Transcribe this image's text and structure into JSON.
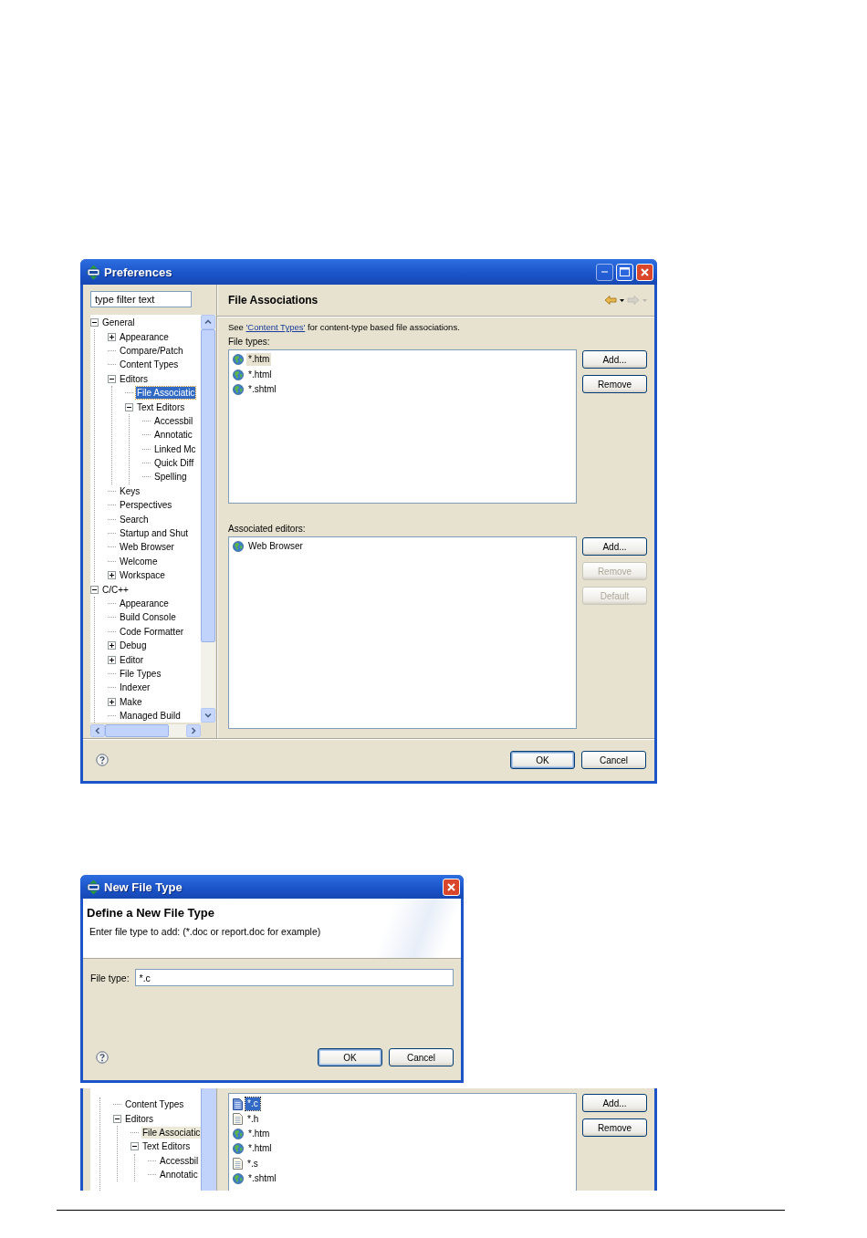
{
  "preferences": {
    "title": "Preferences",
    "filter": {
      "placeholder": "type filter text"
    },
    "tree": {
      "focused": true,
      "items": [
        {
          "label": "General",
          "expanded": true,
          "selected": false,
          "children": [
            {
              "label": "Appearance",
              "expanded": false,
              "selected": false
            },
            {
              "label": "Compare/Patch",
              "selected": false
            },
            {
              "label": "Content Types",
              "selected": false
            },
            {
              "label": "Editors",
              "expanded": true,
              "selected": false,
              "children": [
                {
                  "label": "File Associatic",
                  "selected": true
                },
                {
                  "label": "Text Editors",
                  "expanded": true,
                  "selected": false,
                  "children": [
                    {
                      "label": "Accessbil",
                      "selected": false
                    },
                    {
                      "label": "Annotatic",
                      "selected": false
                    },
                    {
                      "label": "Linked Mc",
                      "selected": false
                    },
                    {
                      "label": "Quick Diff",
                      "selected": false
                    },
                    {
                      "label": "Spelling",
                      "selected": false
                    }
                  ]
                }
              ]
            },
            {
              "label": "Keys",
              "selected": false
            },
            {
              "label": "Perspectives",
              "selected": false
            },
            {
              "label": "Search",
              "selected": false
            },
            {
              "label": "Startup and Shut",
              "selected": false
            },
            {
              "label": "Web Browser",
              "selected": false
            },
            {
              "label": "Welcome",
              "selected": false
            },
            {
              "label": "Workspace",
              "expanded": false,
              "selected": false
            }
          ]
        },
        {
          "label": "C/C++",
          "expanded": true,
          "selected": false,
          "children": [
            {
              "label": "Appearance",
              "selected": false
            },
            {
              "label": "Build Console",
              "selected": false
            },
            {
              "label": "Code Formatter",
              "selected": false
            },
            {
              "label": "Debug",
              "expanded": false,
              "selected": false
            },
            {
              "label": "Editor",
              "expanded": false,
              "selected": false
            },
            {
              "label": "File Types",
              "selected": false
            },
            {
              "label": "Indexer",
              "selected": false
            },
            {
              "label": "Make",
              "expanded": false,
              "selected": false
            },
            {
              "label": "Managed Build",
              "selected": false
            }
          ]
        }
      ]
    },
    "page_title": "File Associations",
    "nav": [
      {
        "kind": "back",
        "disabled": false
      },
      {
        "kind": "forward",
        "disabled": true
      }
    ],
    "description": {
      "before": "See ",
      "link": "'Content Types'",
      "after": " for content-type based file associations."
    },
    "file_types": {
      "label": "File types:",
      "focused": false,
      "items": [
        {
          "label": "*.htm",
          "kind": "web",
          "selected": true
        },
        {
          "label": "*.html",
          "kind": "web",
          "selected": false
        },
        {
          "label": "*.shtml",
          "kind": "web",
          "selected": false
        }
      ]
    },
    "file_type_buttons": [
      {
        "label": "Add...",
        "disabled": false
      },
      {
        "label": "Remove",
        "disabled": false
      }
    ],
    "editors": {
      "label": "Associated editors:",
      "items": [
        {
          "label": "Web Browser",
          "kind": "web",
          "selected": false
        }
      ]
    },
    "editor_buttons": [
      {
        "label": "Add...",
        "disabled": false
      },
      {
        "label": "Remove",
        "disabled": true
      },
      {
        "label": "Default",
        "disabled": true
      }
    ],
    "buttons": [
      {
        "label": "OK",
        "default": true
      },
      {
        "label": "Cancel",
        "default": false
      }
    ]
  },
  "new_file_type": {
    "title": "New File Type",
    "heading": "Define a New File Type",
    "message": "Enter file type to add: (*.doc or report.doc for example)",
    "field": {
      "label": "File type:",
      "value": "*.c"
    },
    "buttons": [
      {
        "label": "OK",
        "default": true
      },
      {
        "label": "Cancel",
        "default": false
      }
    ]
  },
  "detail": {
    "tree": {
      "focused": false,
      "items": [
        {
          "label": "Content Types",
          "selected": false
        },
        {
          "label": "Editors",
          "expanded": true,
          "selected": false,
          "children": [
            {
              "label": "File Associatic",
              "selected": true
            },
            {
              "label": "Text Editors",
              "expanded": true,
              "selected": false,
              "children": [
                {
                  "label": "Accessbil",
                  "selected": false
                },
                {
                  "label": "Annotatic",
                  "selected": false
                }
              ]
            }
          ]
        }
      ]
    },
    "file_types": {
      "focused": true,
      "items": [
        {
          "label": "*.c",
          "kind": "source",
          "selected": true
        },
        {
          "label": "*.h",
          "kind": "text",
          "selected": false
        },
        {
          "label": "*.htm",
          "kind": "web",
          "selected": false
        },
        {
          "label": "*.html",
          "kind": "web",
          "selected": false
        },
        {
          "label": "*.s",
          "kind": "text",
          "selected": false
        },
        {
          "label": "*.shtml",
          "kind": "web",
          "selected": false
        }
      ]
    },
    "buttons": [
      {
        "label": "Add...",
        "disabled": false
      },
      {
        "label": "Remove",
        "disabled": false
      }
    ]
  }
}
